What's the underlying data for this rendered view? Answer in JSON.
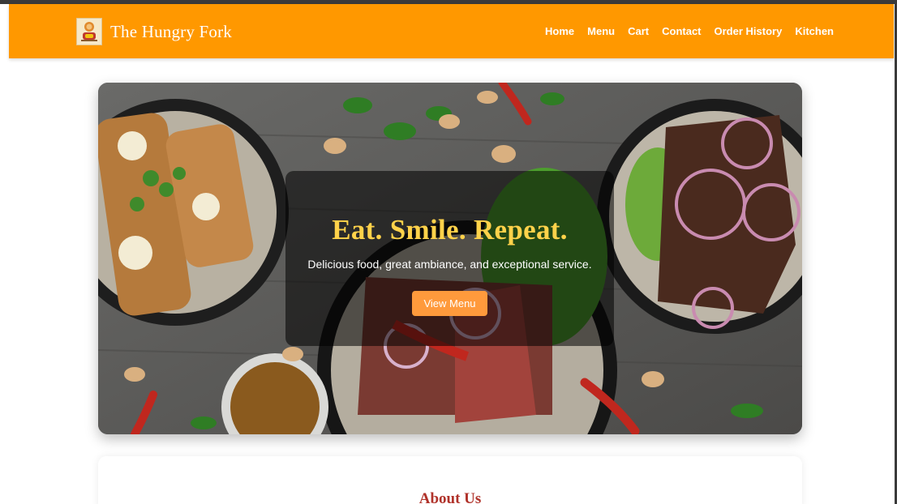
{
  "brand": {
    "name": "The Hungry Fork",
    "logo_icon": "restaurant-logo-icon"
  },
  "nav": {
    "items": [
      {
        "label": "Home"
      },
      {
        "label": "Menu"
      },
      {
        "label": "Cart"
      },
      {
        "label": "Contact"
      },
      {
        "label": "Order History"
      },
      {
        "label": "Kitchen"
      }
    ]
  },
  "hero": {
    "title": "Eat. Smile. Repeat.",
    "subtitle": "Delicious food, great ambiance, and exceptional service.",
    "button_label": "View Menu"
  },
  "about": {
    "title": "About Us"
  },
  "colors": {
    "navbar": "#ff9800",
    "hero_title": "#ffd24a",
    "button": "#ff9a3c",
    "about_title": "#b0322a"
  }
}
